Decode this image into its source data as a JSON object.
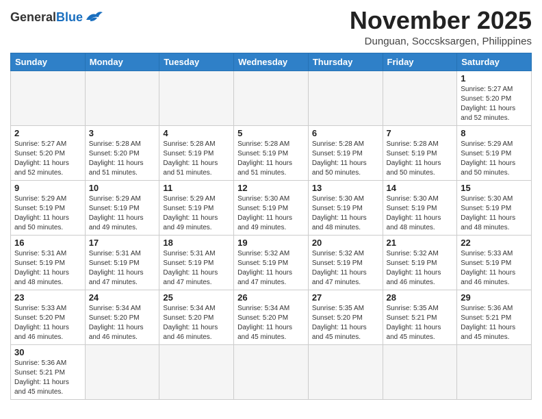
{
  "logo": {
    "general": "General",
    "blue": "Blue"
  },
  "title": {
    "month": "November 2025",
    "location": "Dunguan, Soccsksargen, Philippines"
  },
  "weekdays": [
    "Sunday",
    "Monday",
    "Tuesday",
    "Wednesday",
    "Thursday",
    "Friday",
    "Saturday"
  ],
  "days": [
    {
      "num": "",
      "sunrise": "",
      "sunset": "",
      "daylight": ""
    },
    {
      "num": "",
      "sunrise": "",
      "sunset": "",
      "daylight": ""
    },
    {
      "num": "",
      "sunrise": "",
      "sunset": "",
      "daylight": ""
    },
    {
      "num": "",
      "sunrise": "",
      "sunset": "",
      "daylight": ""
    },
    {
      "num": "",
      "sunrise": "",
      "sunset": "",
      "daylight": ""
    },
    {
      "num": "",
      "sunrise": "",
      "sunset": "",
      "daylight": ""
    },
    {
      "num": "1",
      "sunrise": "Sunrise: 5:27 AM",
      "sunset": "Sunset: 5:20 PM",
      "daylight": "Daylight: 11 hours and 52 minutes."
    },
    {
      "num": "2",
      "sunrise": "Sunrise: 5:27 AM",
      "sunset": "Sunset: 5:20 PM",
      "daylight": "Daylight: 11 hours and 52 minutes."
    },
    {
      "num": "3",
      "sunrise": "Sunrise: 5:28 AM",
      "sunset": "Sunset: 5:20 PM",
      "daylight": "Daylight: 11 hours and 51 minutes."
    },
    {
      "num": "4",
      "sunrise": "Sunrise: 5:28 AM",
      "sunset": "Sunset: 5:19 PM",
      "daylight": "Daylight: 11 hours and 51 minutes."
    },
    {
      "num": "5",
      "sunrise": "Sunrise: 5:28 AM",
      "sunset": "Sunset: 5:19 PM",
      "daylight": "Daylight: 11 hours and 51 minutes."
    },
    {
      "num": "6",
      "sunrise": "Sunrise: 5:28 AM",
      "sunset": "Sunset: 5:19 PM",
      "daylight": "Daylight: 11 hours and 50 minutes."
    },
    {
      "num": "7",
      "sunrise": "Sunrise: 5:28 AM",
      "sunset": "Sunset: 5:19 PM",
      "daylight": "Daylight: 11 hours and 50 minutes."
    },
    {
      "num": "8",
      "sunrise": "Sunrise: 5:29 AM",
      "sunset": "Sunset: 5:19 PM",
      "daylight": "Daylight: 11 hours and 50 minutes."
    },
    {
      "num": "9",
      "sunrise": "Sunrise: 5:29 AM",
      "sunset": "Sunset: 5:19 PM",
      "daylight": "Daylight: 11 hours and 50 minutes."
    },
    {
      "num": "10",
      "sunrise": "Sunrise: 5:29 AM",
      "sunset": "Sunset: 5:19 PM",
      "daylight": "Daylight: 11 hours and 49 minutes."
    },
    {
      "num": "11",
      "sunrise": "Sunrise: 5:29 AM",
      "sunset": "Sunset: 5:19 PM",
      "daylight": "Daylight: 11 hours and 49 minutes."
    },
    {
      "num": "12",
      "sunrise": "Sunrise: 5:30 AM",
      "sunset": "Sunset: 5:19 PM",
      "daylight": "Daylight: 11 hours and 49 minutes."
    },
    {
      "num": "13",
      "sunrise": "Sunrise: 5:30 AM",
      "sunset": "Sunset: 5:19 PM",
      "daylight": "Daylight: 11 hours and 48 minutes."
    },
    {
      "num": "14",
      "sunrise": "Sunrise: 5:30 AM",
      "sunset": "Sunset: 5:19 PM",
      "daylight": "Daylight: 11 hours and 48 minutes."
    },
    {
      "num": "15",
      "sunrise": "Sunrise: 5:30 AM",
      "sunset": "Sunset: 5:19 PM",
      "daylight": "Daylight: 11 hours and 48 minutes."
    },
    {
      "num": "16",
      "sunrise": "Sunrise: 5:31 AM",
      "sunset": "Sunset: 5:19 PM",
      "daylight": "Daylight: 11 hours and 48 minutes."
    },
    {
      "num": "17",
      "sunrise": "Sunrise: 5:31 AM",
      "sunset": "Sunset: 5:19 PM",
      "daylight": "Daylight: 11 hours and 47 minutes."
    },
    {
      "num": "18",
      "sunrise": "Sunrise: 5:31 AM",
      "sunset": "Sunset: 5:19 PM",
      "daylight": "Daylight: 11 hours and 47 minutes."
    },
    {
      "num": "19",
      "sunrise": "Sunrise: 5:32 AM",
      "sunset": "Sunset: 5:19 PM",
      "daylight": "Daylight: 11 hours and 47 minutes."
    },
    {
      "num": "20",
      "sunrise": "Sunrise: 5:32 AM",
      "sunset": "Sunset: 5:19 PM",
      "daylight": "Daylight: 11 hours and 47 minutes."
    },
    {
      "num": "21",
      "sunrise": "Sunrise: 5:32 AM",
      "sunset": "Sunset: 5:19 PM",
      "daylight": "Daylight: 11 hours and 46 minutes."
    },
    {
      "num": "22",
      "sunrise": "Sunrise: 5:33 AM",
      "sunset": "Sunset: 5:19 PM",
      "daylight": "Daylight: 11 hours and 46 minutes."
    },
    {
      "num": "23",
      "sunrise": "Sunrise: 5:33 AM",
      "sunset": "Sunset: 5:20 PM",
      "daylight": "Daylight: 11 hours and 46 minutes."
    },
    {
      "num": "24",
      "sunrise": "Sunrise: 5:34 AM",
      "sunset": "Sunset: 5:20 PM",
      "daylight": "Daylight: 11 hours and 46 minutes."
    },
    {
      "num": "25",
      "sunrise": "Sunrise: 5:34 AM",
      "sunset": "Sunset: 5:20 PM",
      "daylight": "Daylight: 11 hours and 46 minutes."
    },
    {
      "num": "26",
      "sunrise": "Sunrise: 5:34 AM",
      "sunset": "Sunset: 5:20 PM",
      "daylight": "Daylight: 11 hours and 45 minutes."
    },
    {
      "num": "27",
      "sunrise": "Sunrise: 5:35 AM",
      "sunset": "Sunset: 5:20 PM",
      "daylight": "Daylight: 11 hours and 45 minutes."
    },
    {
      "num": "28",
      "sunrise": "Sunrise: 5:35 AM",
      "sunset": "Sunset: 5:21 PM",
      "daylight": "Daylight: 11 hours and 45 minutes."
    },
    {
      "num": "29",
      "sunrise": "Sunrise: 5:36 AM",
      "sunset": "Sunset: 5:21 PM",
      "daylight": "Daylight: 11 hours and 45 minutes."
    },
    {
      "num": "30",
      "sunrise": "Sunrise: 5:36 AM",
      "sunset": "Sunset: 5:21 PM",
      "daylight": "Daylight: 11 hours and 45 minutes."
    }
  ]
}
